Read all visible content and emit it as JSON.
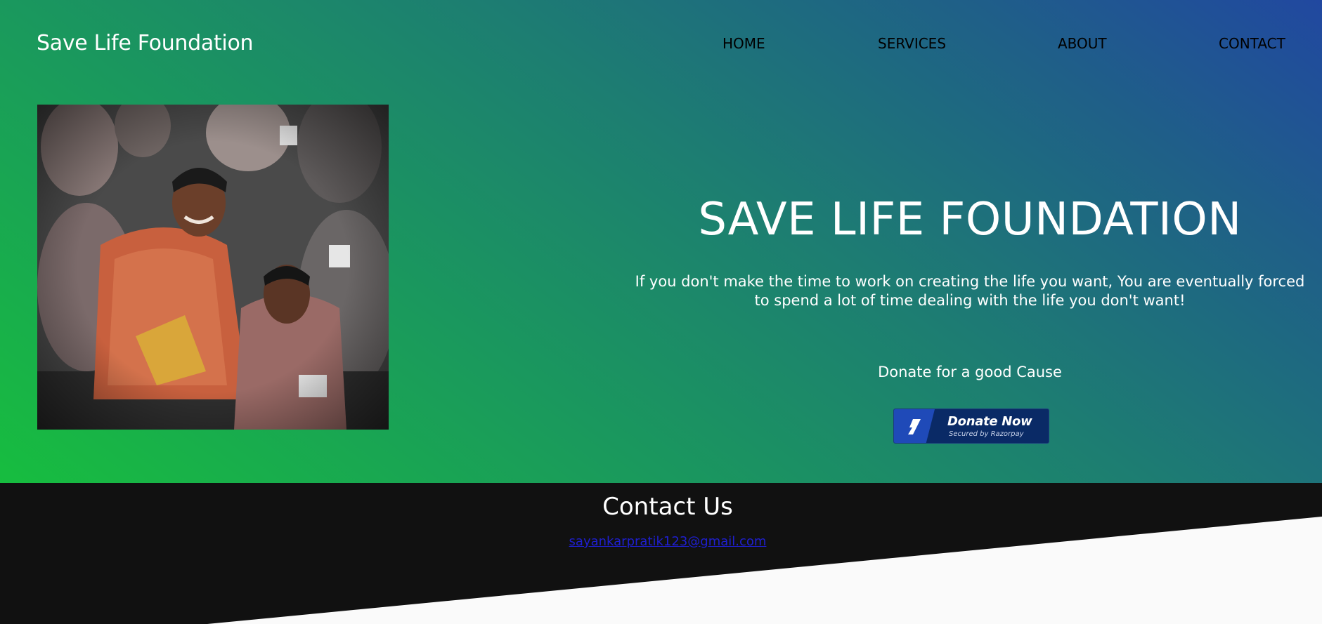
{
  "brand": "Save Life Foundation",
  "nav": {
    "home": "HOME",
    "services": "SERVICES",
    "about": "ABOUT",
    "contact": "CONTACT"
  },
  "hero": {
    "title": "SAVE LIFE FOUNDATION",
    "quote": "If you don't make the time to work on creating the life you want, You are eventually forced to spend a lot of time dealing with the life you don't want!",
    "donate_prompt": "Donate for a good Cause"
  },
  "donate_button": {
    "label": "Donate Now",
    "sublabel": "Secured by Razorpay"
  },
  "contact": {
    "title": "Contact Us",
    "email": "sayankarpratik123@gmail.com"
  },
  "colors": {
    "gradient_start": "#17bd3f",
    "gradient_end": "#2148a0",
    "footer_bg": "#111111",
    "button_bg": "#0a2a66",
    "link": "#1f1fd0"
  }
}
